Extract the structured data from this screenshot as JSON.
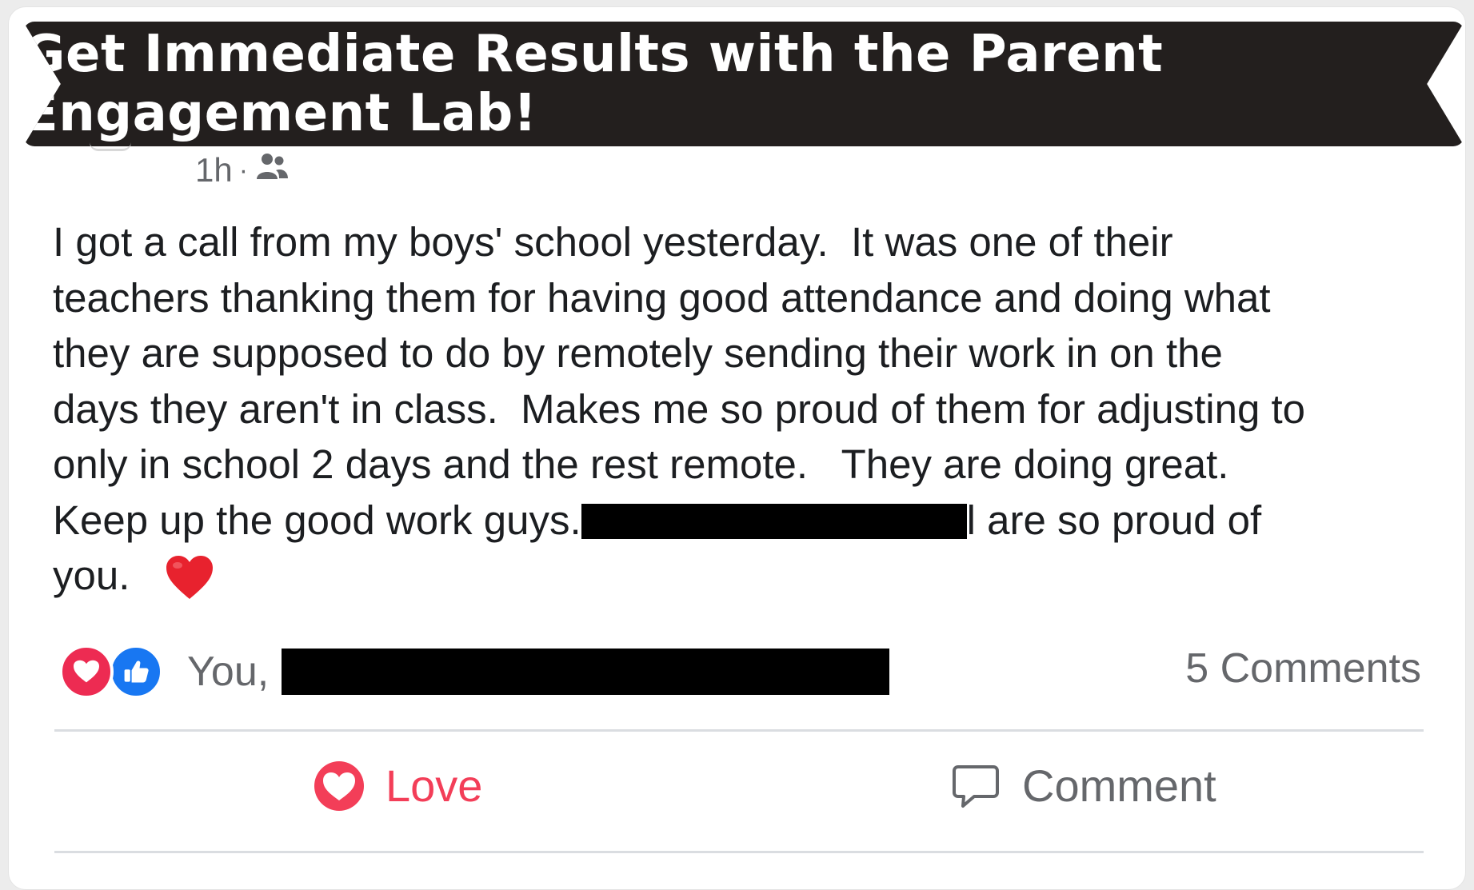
{
  "banner": {
    "text": "Get Immediate Results with the Parent Engagement Lab!"
  },
  "post": {
    "time": "1h",
    "separator": "·",
    "privacy_icon": "friends-icon",
    "lines": [
      "I got a call from my boys' school yesterday.  It was one of their",
      "teachers thanking them for having good attendance and doing what",
      "they are supposed to do by remotely sending their work in on the",
      "days they aren't in class.  Makes me so proud of them for adjusting to",
      "only in school 2 days and the rest remote.   They are doing great."
    ],
    "line6_before": "Keep up the good work guys.",
    "line6_after": "l are so proud of",
    "line7": "you.",
    "emoji": "red-heart-emoji"
  },
  "reactions": {
    "icons": [
      "love-reaction-icon",
      "like-reaction-icon"
    ],
    "text": "You,",
    "comments_count": "5 Comments"
  },
  "actions": {
    "love_label": "Love",
    "comment_label": "Comment"
  },
  "colors": {
    "banner_bg": "#231f1e",
    "love_red": "#f33e58",
    "like_blue": "#1877f2",
    "secondary_text": "#65676b"
  }
}
